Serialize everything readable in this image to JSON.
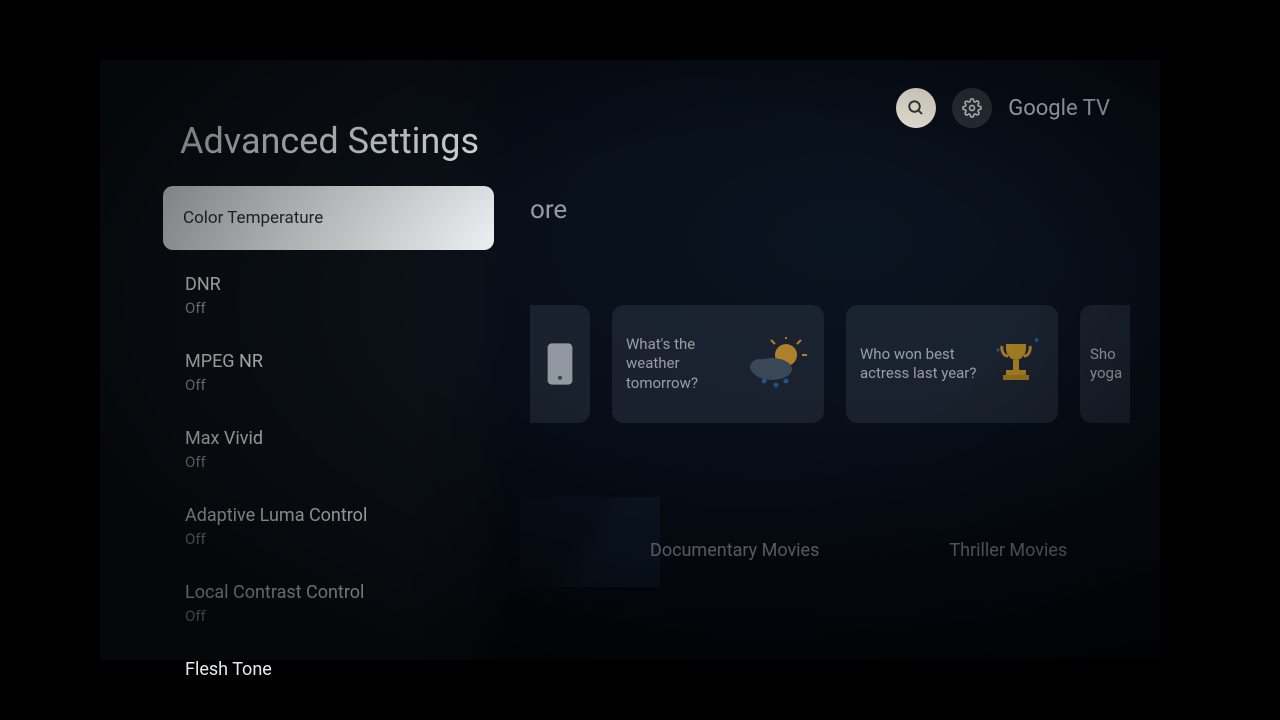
{
  "header": {
    "brand": "Google TV"
  },
  "background": {
    "section_text": "ore",
    "cards": [
      {
        "text": "What's the weather tomorrow?"
      },
      {
        "text": "Who won best actress last year?"
      },
      {
        "text_partial": "Sho\nyoga"
      }
    ],
    "categories": [
      "Documentary Movies",
      "Thriller Movies"
    ]
  },
  "panel": {
    "title": "Advanced Settings",
    "items": [
      {
        "label": "Color Temperature",
        "value": null,
        "selected": true
      },
      {
        "label": "DNR",
        "value": "Off"
      },
      {
        "label": "MPEG NR",
        "value": "Off"
      },
      {
        "label": "Max Vivid",
        "value": "Off"
      },
      {
        "label": "Adaptive Luma Control",
        "value": "Off"
      },
      {
        "label": "Local Contrast Control",
        "value": "Off"
      },
      {
        "label": "Flesh Tone",
        "value": null
      }
    ]
  }
}
